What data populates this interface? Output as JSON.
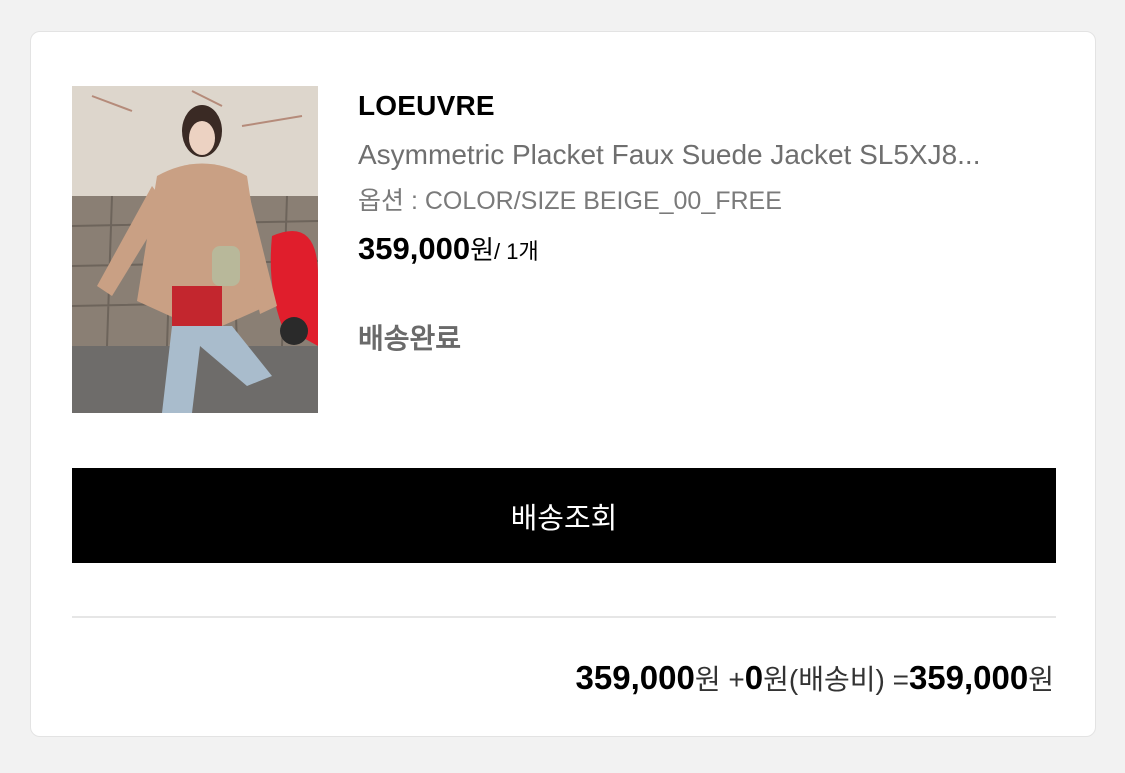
{
  "product": {
    "image_alt": "woman wearing beige faux suede jacket",
    "brand": "LOEUVRE",
    "name": "Asymmetric Placket Faux Suede Jacket SL5XJ8...",
    "option": "옵션 : COLOR/SIZE BEIGE_00_FREE",
    "price": "359,000",
    "currency": "원",
    "quantity": "/ 1개",
    "status": "배송완료"
  },
  "actions": {
    "track_label": "배송조회"
  },
  "summary": {
    "item_total": "359,000",
    "item_unit": "원",
    "plus": " +",
    "shipping": "0",
    "shipping_unit": "원(배송비) =",
    "grand_total": "359,000",
    "grand_unit": "원"
  },
  "colors": {
    "background": "#f2f2f2",
    "card": "#ffffff",
    "button": "#000000",
    "button_text": "#ffffff"
  }
}
